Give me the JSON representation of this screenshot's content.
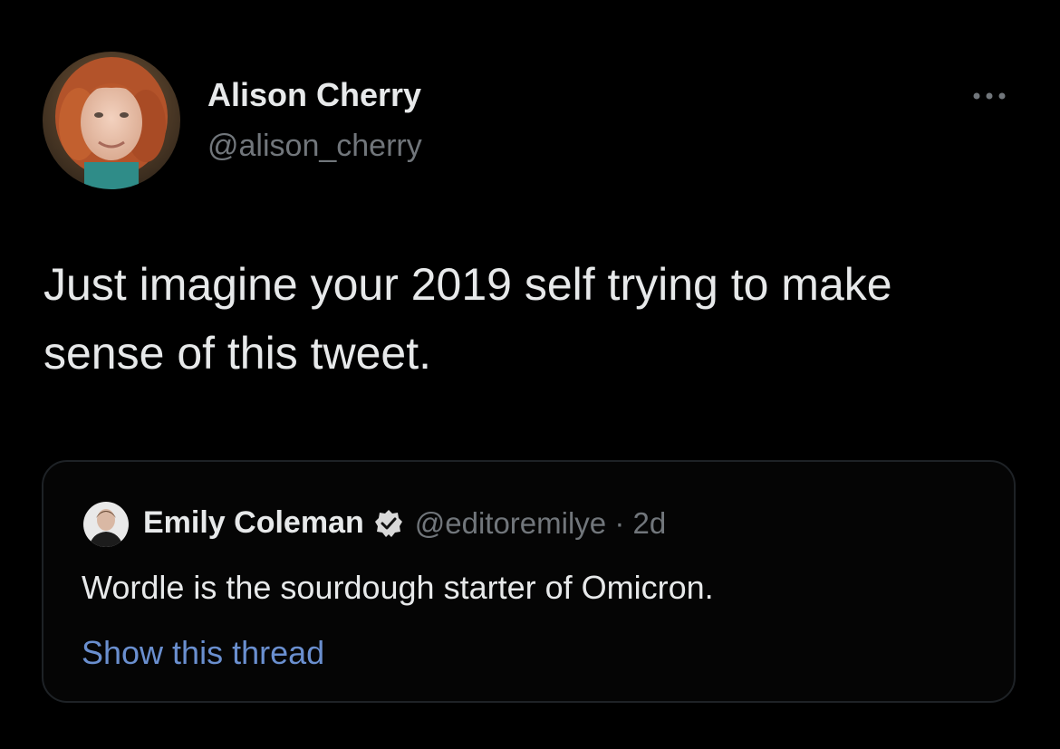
{
  "tweet": {
    "author": {
      "display_name": "Alison Cherry",
      "handle": "@alison_cherry",
      "avatar_icon": "profile-photo"
    },
    "more_icon": "more-horizontal-icon",
    "text": "Just imagine your 2019 self trying to make sense of this tweet."
  },
  "quote": {
    "author": {
      "display_name": "Emily Coleman",
      "verified": true,
      "verified_icon": "verified-badge-icon",
      "handle_time": "@editoremilye · 2d"
    },
    "text": "Wordle is the sourdough starter of Omicron.",
    "show_thread_label": "Show this thread"
  },
  "colors": {
    "background": "#000000",
    "primary_text": "#e7e9ea",
    "secondary_text": "#71767b",
    "link": "#6a8fcf",
    "card_border": "#1e2226"
  }
}
